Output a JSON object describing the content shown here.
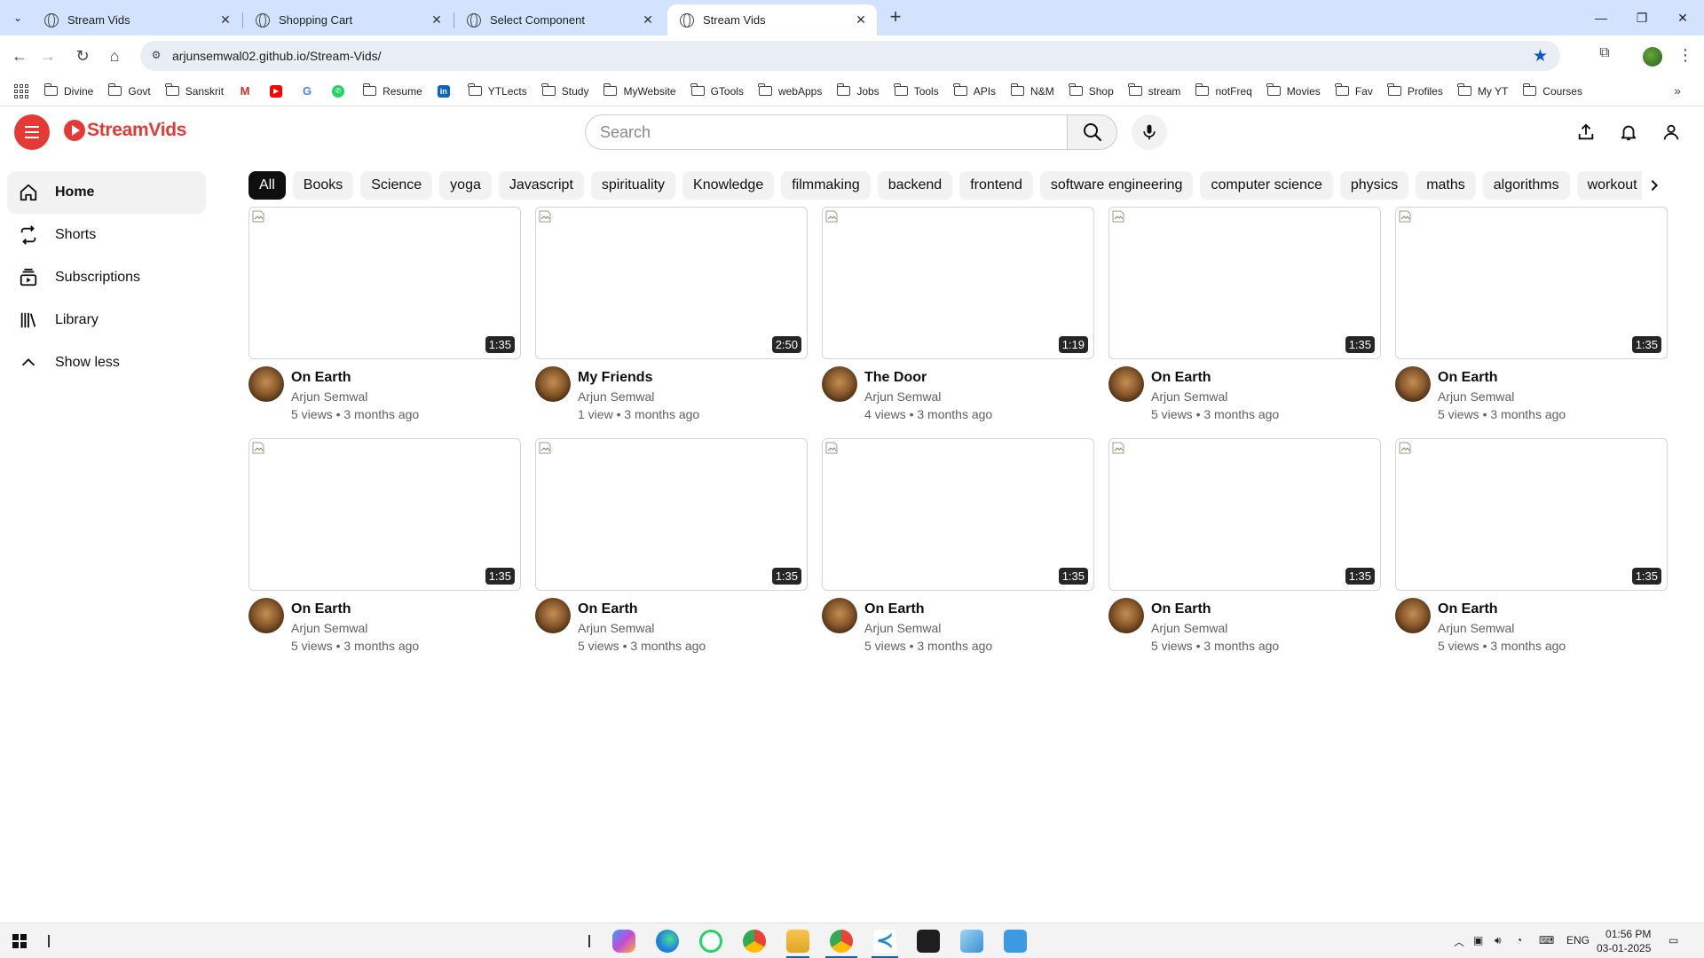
{
  "browser": {
    "tabs": [
      {
        "title": "Stream Vids",
        "active": false
      },
      {
        "title": "Shopping Cart",
        "active": false
      },
      {
        "title": "Select Component",
        "active": false
      },
      {
        "title": "Stream Vids",
        "active": true
      }
    ],
    "url": "arjunsemwal02.github.io/Stream-Vids/",
    "bookmarks": [
      {
        "label": "Divine",
        "icon": "folder-icon"
      },
      {
        "label": "Govt",
        "icon": "folder-icon"
      },
      {
        "label": "Sanskrit",
        "icon": "folder-icon"
      },
      {
        "label": "",
        "icon": "gmail-icon"
      },
      {
        "label": "",
        "icon": "youtube-icon"
      },
      {
        "label": "",
        "icon": "google-icon"
      },
      {
        "label": "",
        "icon": "whatsapp-icon"
      },
      {
        "label": "Resume",
        "icon": "folder-icon"
      },
      {
        "label": "",
        "icon": "linkedin-icon"
      },
      {
        "label": "YTLects",
        "icon": "folder-icon"
      },
      {
        "label": "Study",
        "icon": "folder-icon"
      },
      {
        "label": "MyWebsite",
        "icon": "folder-icon"
      },
      {
        "label": "GTools",
        "icon": "folder-icon"
      },
      {
        "label": "webApps",
        "icon": "folder-icon"
      },
      {
        "label": "Jobs",
        "icon": "folder-icon"
      },
      {
        "label": "Tools",
        "icon": "folder-icon"
      },
      {
        "label": "APIs",
        "icon": "folder-icon"
      },
      {
        "label": "N&M",
        "icon": "folder-icon"
      },
      {
        "label": "Shop",
        "icon": "folder-icon"
      },
      {
        "label": "stream",
        "icon": "folder-icon"
      },
      {
        "label": "notFreq",
        "icon": "folder-icon"
      },
      {
        "label": "Movies",
        "icon": "folder-icon"
      },
      {
        "label": "Fav",
        "icon": "folder-icon"
      },
      {
        "label": "Profiles",
        "icon": "folder-icon"
      },
      {
        "label": "My YT",
        "icon": "folder-icon"
      },
      {
        "label": "Courses",
        "icon": "folder-icon"
      }
    ]
  },
  "app": {
    "brand": "StreamVids",
    "brand_color": "#e53935",
    "search": {
      "placeholder": "Search",
      "value": ""
    },
    "sidebar": [
      {
        "label": "Home",
        "icon": "home-icon",
        "active": true
      },
      {
        "label": "Shorts",
        "icon": "shorts-icon",
        "active": false
      },
      {
        "label": "Subscriptions",
        "icon": "subscriptions-icon",
        "active": false
      },
      {
        "label": "Library",
        "icon": "library-icon",
        "active": false
      },
      {
        "label": "Show less",
        "icon": "chevron-up-icon",
        "active": false
      }
    ],
    "chips": [
      "All",
      "Books",
      "Science",
      "yoga",
      "Javascript",
      "spirituality",
      "Knowledge",
      "filmmaking",
      "backend",
      "frontend",
      "software engineering",
      "computer science",
      "physics",
      "maths",
      "algorithms",
      "workout"
    ],
    "videos": [
      {
        "title": "On Earth",
        "channel": "Arjun Semwal",
        "stats": "5 views • 3 months ago",
        "duration": "1:35"
      },
      {
        "title": "My Friends",
        "channel": "Arjun Semwal",
        "stats": "1 view • 3 months ago",
        "duration": "2:50"
      },
      {
        "title": "The Door",
        "channel": "Arjun Semwal",
        "stats": "4 views • 3 months ago",
        "duration": "1:19"
      },
      {
        "title": "On Earth",
        "channel": "Arjun Semwal",
        "stats": "5 views • 3 months ago",
        "duration": "1:35"
      },
      {
        "title": "On Earth",
        "channel": "Arjun Semwal",
        "stats": "5 views • 3 months ago",
        "duration": "1:35"
      },
      {
        "title": "On Earth",
        "channel": "Arjun Semwal",
        "stats": "5 views • 3 months ago",
        "duration": "1:35"
      },
      {
        "title": "On Earth",
        "channel": "Arjun Semwal",
        "stats": "5 views • 3 months ago",
        "duration": "1:35"
      },
      {
        "title": "On Earth",
        "channel": "Arjun Semwal",
        "stats": "5 views • 3 months ago",
        "duration": "1:35"
      },
      {
        "title": "On Earth",
        "channel": "Arjun Semwal",
        "stats": "5 views • 3 months ago",
        "duration": "1:35"
      },
      {
        "title": "On Earth",
        "channel": "Arjun Semwal",
        "stats": "5 views • 3 months ago",
        "duration": "1:35"
      }
    ]
  },
  "taskbar": {
    "language": "ENG",
    "time": "01:56 PM",
    "date": "03-01-2025",
    "apps": [
      "copilot-icon",
      "edge-icon",
      "whatsapp-icon",
      "chrome-icon",
      "file-explorer-icon",
      "chrome-active-icon",
      "vscode-icon",
      "terminal-icon",
      "notepad-icon",
      "remote-desktop-icon"
    ]
  }
}
